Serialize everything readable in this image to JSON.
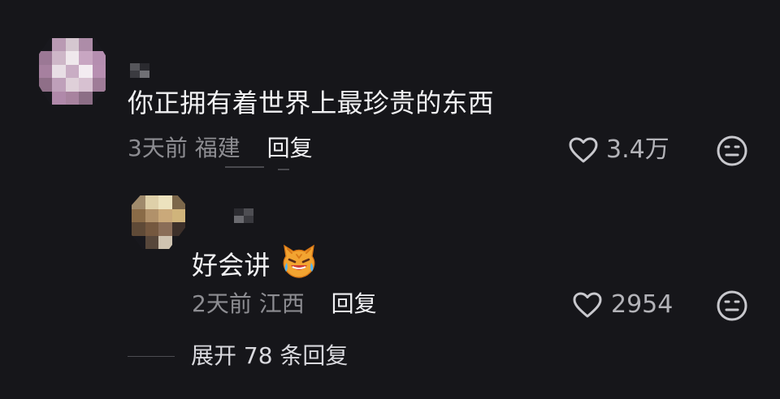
{
  "comments": [
    {
      "text": "你正拥有着世界上最珍贵的东西",
      "time": "3天前",
      "location": "福建",
      "reply_label": "回复",
      "likes": "3.4万",
      "heart_icon": "heart-outline-icon",
      "emoji_icon": "neutral-face-icon"
    },
    {
      "text": "好会讲",
      "time": "2天前",
      "location": "江西",
      "reply_label": "回复",
      "likes": "2954",
      "heart_icon": "heart-outline-icon",
      "emoji_icon": "neutral-face-icon",
      "inline_emoji_icon": "laughing-cat-emoji"
    }
  ],
  "expand_replies": {
    "label": "展开 78 条回复"
  },
  "colors": {
    "background": "#16161a",
    "primary_text": "#f1f1f3",
    "secondary_text": "#8d8d92",
    "count_text": "#b3b3b8"
  }
}
